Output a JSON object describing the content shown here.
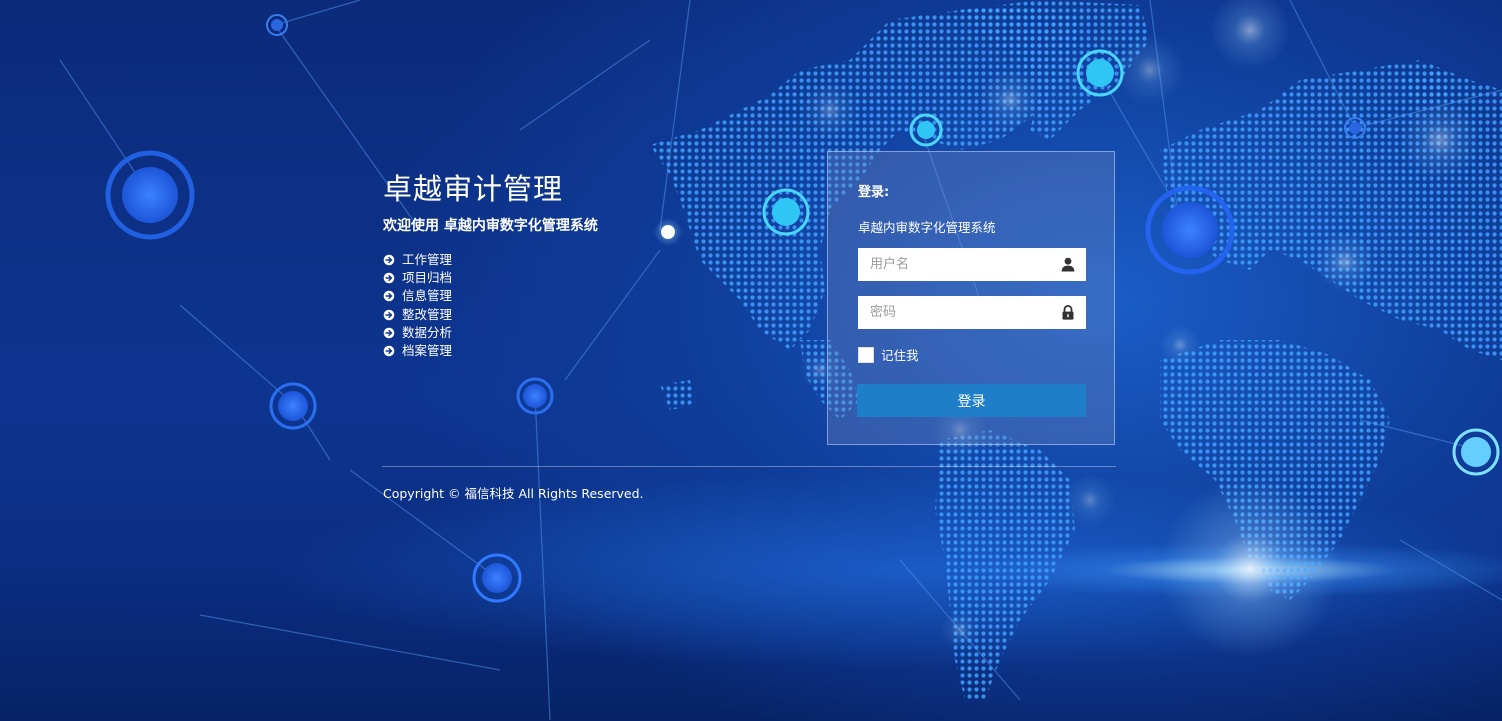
{
  "brand": {
    "title": "卓越审计管理",
    "subtitle": "欢迎使用 卓越内审数字化管理系统"
  },
  "features": [
    {
      "label": "工作管理",
      "icon": "circle-arrow-right-icon"
    },
    {
      "label": "项目归档",
      "icon": "circle-arrow-right-icon"
    },
    {
      "label": "信息管理",
      "icon": "circle-arrow-right-icon"
    },
    {
      "label": "整改管理",
      "icon": "circle-arrow-right-icon"
    },
    {
      "label": "数据分析",
      "icon": "circle-arrow-right-icon"
    },
    {
      "label": "档案管理",
      "icon": "circle-arrow-right-icon"
    }
  ],
  "login": {
    "heading": "登录:",
    "system_name": "卓越内审数字化管理系统",
    "username": {
      "value": "",
      "placeholder": "用户名",
      "icon": "user-icon"
    },
    "password": {
      "value": "",
      "placeholder": "密码",
      "icon": "lock-icon"
    },
    "remember_label": "记住我",
    "remember_checked": false,
    "submit_label": "登录"
  },
  "footer": {
    "copyright": "Copyright © 福信科技 All Rights Reserved."
  },
  "colors": {
    "background_dark": "#0b2b7a",
    "background_mid": "#1a5ec8",
    "map_dot": "#3fa0ff",
    "button": "#1e7fc8",
    "text": "#ffffff"
  }
}
